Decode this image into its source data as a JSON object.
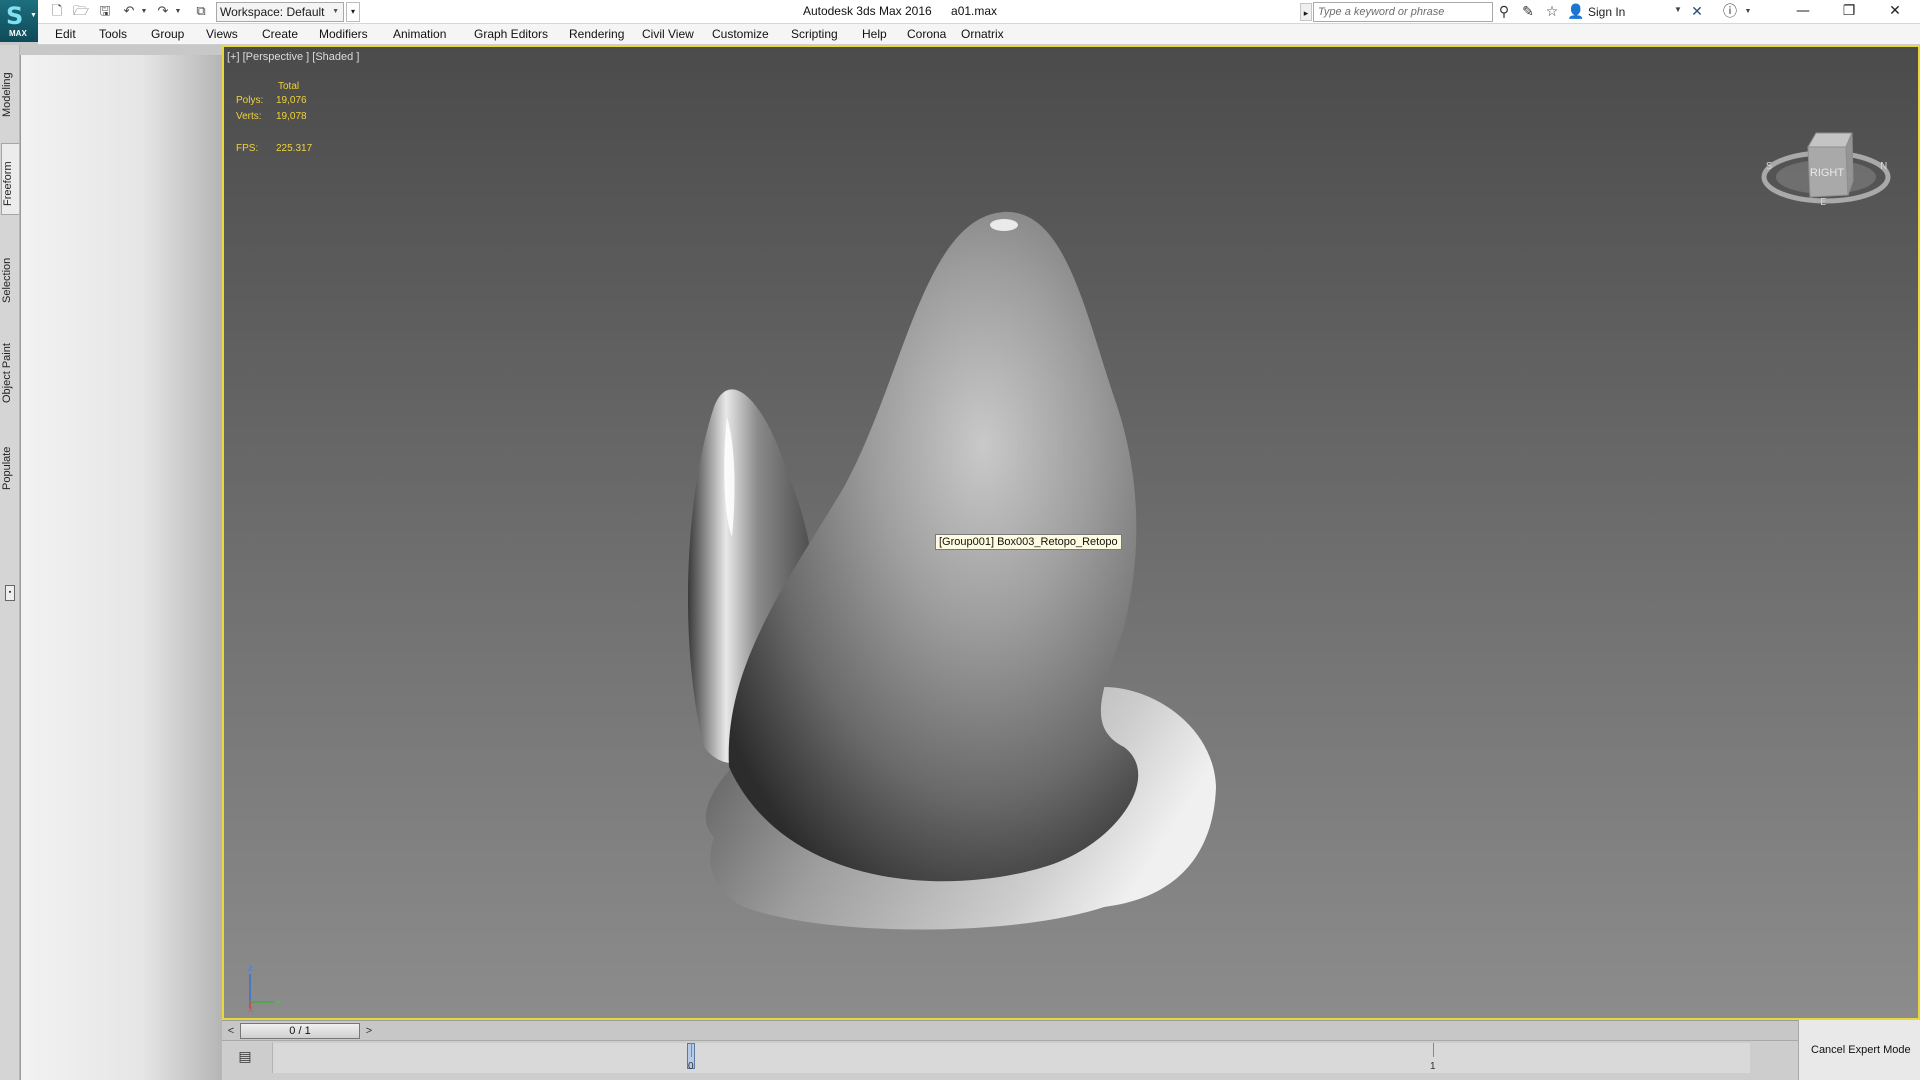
{
  "titlebar": {
    "app_name": "Autodesk 3ds Max 2016",
    "file_name": "a01.max",
    "logo_text": "MAX",
    "workspace_label": "Workspace: Default",
    "search_placeholder": "Type a keyword or phrase",
    "sign_in": "Sign In"
  },
  "menubar": {
    "items": [
      "Edit",
      "Tools",
      "Group",
      "Views",
      "Create",
      "Modifiers",
      "Animation",
      "Graph Editors",
      "Rendering",
      "Civil View",
      "Customize",
      "Scripting",
      "Help",
      "Corona",
      "Ornatrix"
    ]
  },
  "ribbon": {
    "tabs": [
      "Modeling",
      "Freeform",
      "Selection",
      "Object Paint",
      "Populate"
    ],
    "active_tab": "Freeform"
  },
  "viewport": {
    "label": "[+] [Perspective ] [Shaded ]",
    "stats": {
      "total_label": "Total",
      "polys_label": "Polys:",
      "polys_value": "19,076",
      "verts_label": "Verts:",
      "verts_value": "19,078",
      "fps_label": "FPS:",
      "fps_value": "225.317"
    },
    "tooltip": "[Group001] Box003_Retopo_Retopo",
    "viewcube_label": "RIGHT",
    "axis": {
      "z": "z",
      "y": "y",
      "x": "x"
    },
    "border_color": "#e8d83a"
  },
  "timeline": {
    "slider_label": "0 / 1",
    "prev": "<",
    "next": ">",
    "tick_start": "0",
    "tick_end": "1"
  },
  "expert": {
    "cancel_label": "Cancel Expert Mode"
  },
  "icons": [
    "max-logo-icon",
    "new-file-icon",
    "open-file-icon",
    "save-icon",
    "undo-icon",
    "redo-icon",
    "project-icon",
    "binoculars-icon",
    "community-icon",
    "favorites-icon",
    "user-icon",
    "exchange-icon",
    "help-icon",
    "minimize-icon",
    "restore-icon",
    "close-icon",
    "curve-editor-icon"
  ]
}
